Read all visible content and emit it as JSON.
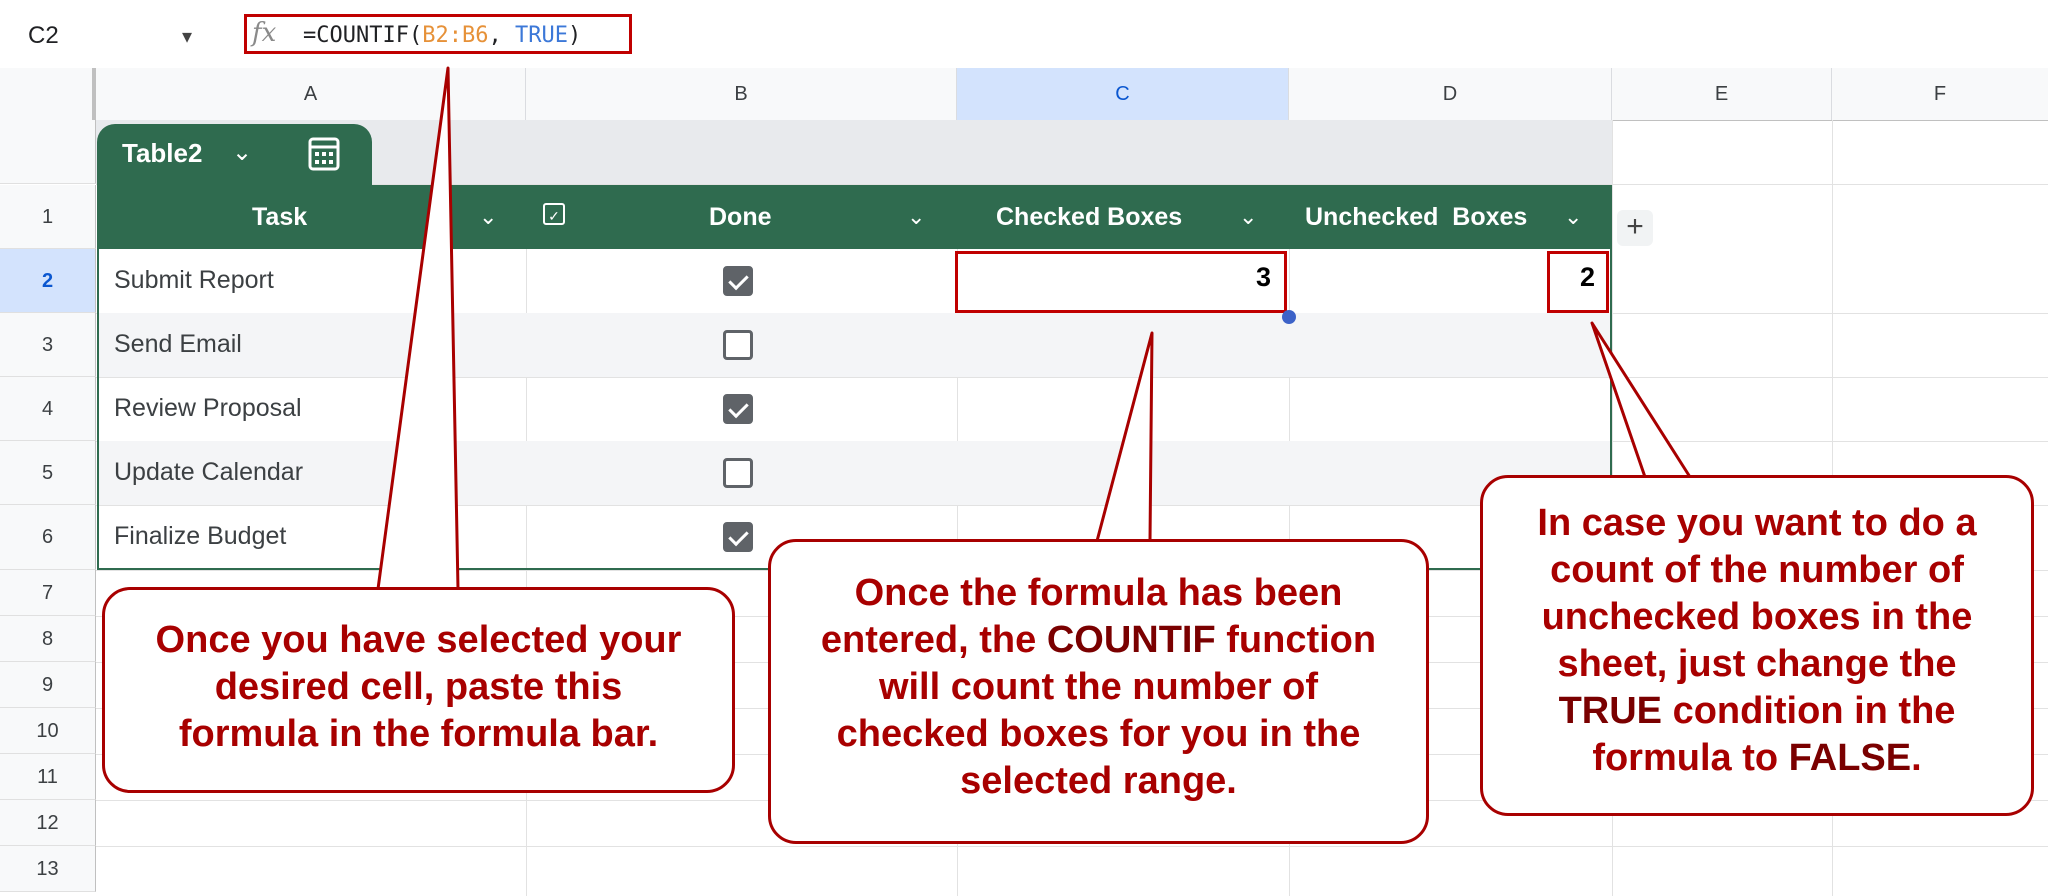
{
  "formula_bar": {
    "name_box": "C2",
    "fx_label": "fx",
    "formula_prefix": "=COUNTIF(",
    "formula_range": "B2:B6",
    "formula_sep": ", ",
    "formula_arg": "TRUE",
    "formula_suffix": ")"
  },
  "columns": [
    "A",
    "B",
    "C",
    "D",
    "E",
    "F"
  ],
  "selected_column": "C",
  "rows": [
    "1",
    "2",
    "3",
    "4",
    "5",
    "6",
    "7",
    "8",
    "9",
    "10",
    "11",
    "12",
    "13"
  ],
  "selected_row": "2",
  "table": {
    "name": "Table2",
    "headers": {
      "task": "Task",
      "done": "Done",
      "checked": "Checked Boxes",
      "unchecked": "Unchecked  Boxes"
    },
    "tasks": [
      {
        "name": "Submit Report",
        "done": true
      },
      {
        "name": "Send Email",
        "done": false
      },
      {
        "name": "Review Proposal",
        "done": true
      },
      {
        "name": "Update Calendar",
        "done": false
      },
      {
        "name": "Finalize Budget",
        "done": true
      }
    ],
    "checked_count": "3",
    "unchecked_count": "2"
  },
  "callouts": {
    "left": {
      "line1": "Once you have selected your",
      "line2": "desired cell, paste this",
      "line3": "formula in the formula bar."
    },
    "middle": {
      "line1": "Once the formula has been",
      "line2a": "entered, the ",
      "line2b": "COUNTIF",
      "line2c": " function",
      "line3": "will count the number of",
      "line4": "checked boxes for you in the",
      "line5": "selected range."
    },
    "right": {
      "line1": "In case you want to do a",
      "line2": "count of the number of",
      "line3": "unchecked boxes in the",
      "line4": "sheet, just change the",
      "line5a": "TRUE",
      "line5b": " condition in the",
      "line6a": "formula to ",
      "line6b": "FALSE",
      "line6c": "."
    }
  },
  "colors": {
    "table_green": "#2f6b4f",
    "callout_red": "#a80000",
    "highlight_red": "#c00000",
    "selection_blue": "#d3e3fd"
  }
}
